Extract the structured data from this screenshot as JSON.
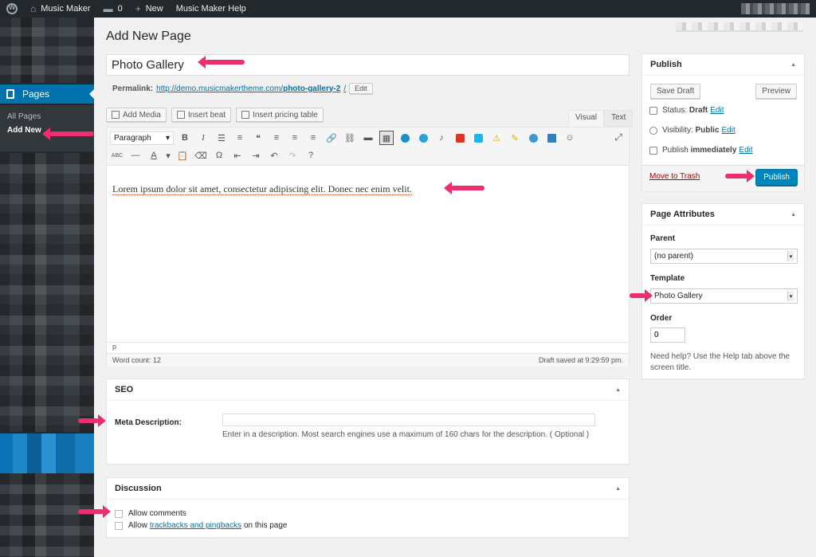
{
  "adminbar": {
    "site_name": "Music Maker",
    "comments_count": "0",
    "new_label": "New",
    "help_label": "Music Maker Help"
  },
  "sidebar": {
    "pages_label": "Pages",
    "submenu": [
      "All Pages",
      "Add New"
    ]
  },
  "page_title": "Add New Page",
  "post_title": "Photo Gallery",
  "permalink": {
    "label": "Permalink:",
    "base_url": "http://demo.musicmakertheme.com/",
    "slug": "photo-gallery-2",
    "trail": "/",
    "edit_label": "Edit"
  },
  "media_buttons": [
    "Add Media",
    "Insert beat",
    "Insert pricing table"
  ],
  "editor": {
    "tabs": {
      "visual": "Visual",
      "text": "Text"
    },
    "format_select": "Paragraph",
    "content": "Lorem ipsum dolor sit amet, consectetur adipiscing elit. Donec nec enim velit.",
    "path": "p",
    "word_count": "Word count: 12",
    "draft_status": "Draft saved at 9:29:59 pm."
  },
  "seo": {
    "title": "SEO",
    "meta_label": "Meta Description:",
    "meta_value": "",
    "help": "Enter in a description. Most search engines use a maximum of 160 chars for the description. ( Optional )"
  },
  "discussion": {
    "title": "Discussion",
    "allow_comments": "Allow comments",
    "allow_prefix": "Allow",
    "trackbacks_link": "trackbacks and pingbacks",
    "allow_suffix": "on this page"
  },
  "publish": {
    "title": "Publish",
    "save_draft": "Save Draft",
    "preview": "Preview",
    "status_label": "Status:",
    "status_value": "Draft",
    "visibility_label": "Visibility:",
    "visibility_value": "Public",
    "publish_label": "Publish",
    "publish_value": "immediately",
    "edit": "Edit",
    "trash": "Move to Trash",
    "publish_button": "Publish"
  },
  "attributes": {
    "title": "Page Attributes",
    "parent_label": "Parent",
    "parent_value": "(no parent)",
    "template_label": "Template",
    "template_value": "Photo Gallery",
    "order_label": "Order",
    "order_value": "0",
    "help": "Need help? Use the Help tab above the screen title."
  },
  "colors": {
    "accent": "#0073aa",
    "primary_button": "#0085ba",
    "annotation": "#ee2d6e",
    "adminbar": "#23282d"
  }
}
